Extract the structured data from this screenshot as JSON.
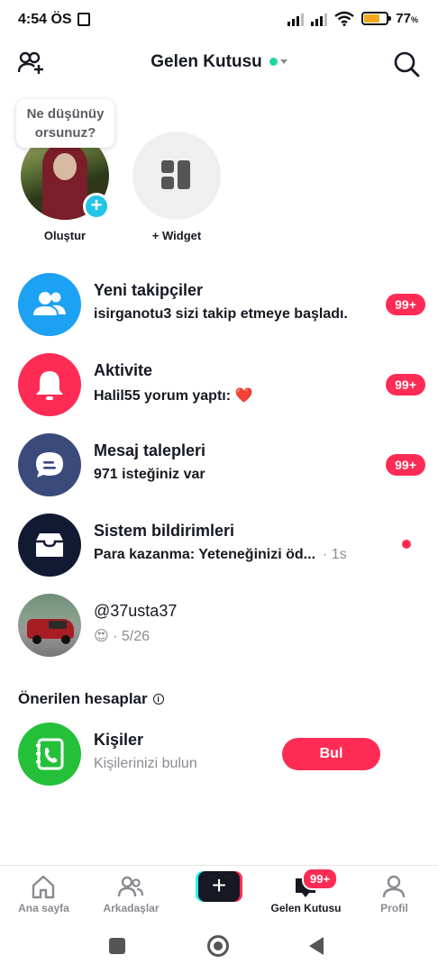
{
  "status_bar": {
    "time": "4:54 ÖS",
    "battery_percent": "77",
    "battery_unit": "%",
    "battery_level": 0.77
  },
  "header": {
    "title": "Gelen Kutusu",
    "status_color": "#20d5a0",
    "left_icon": "add-friend-icon",
    "right_icon": "search-icon"
  },
  "stories": {
    "bubble_text": "Ne düşünüy orsunuz?",
    "create_label": "Oluştur",
    "widget_label": "+ Widget"
  },
  "inbox": [
    {
      "title": "Yeni takipçiler",
      "subtitle": "isirganotu3 sizi takip etmeye başladı.",
      "badge": "99+",
      "icon": "followers-icon",
      "color": "#1da1f2"
    },
    {
      "title": "Aktivite",
      "subtitle": "Halil55 yorum yaptı: ",
      "emoji": "❤️",
      "badge": "99+",
      "icon": "bell-icon",
      "color": "#fe2c55"
    },
    {
      "title": "Mesaj talepleri",
      "subtitle": "971 isteğiniz var",
      "badge": "99+",
      "icon": "message-icon",
      "color": "#3a4a7a"
    },
    {
      "title": "Sistem bildirimleri",
      "subtitle": "Para kazanma: Yeteneğinizi öd...",
      "time": "· 1s",
      "icon": "inbox-tray-icon",
      "color": "#121a33"
    },
    {
      "title": "@37usta37",
      "emoji": "😍",
      "subtitle": " · 5/26"
    }
  ],
  "suggested": {
    "section_title": "Önerilen hesaplar",
    "name": "Kişiler",
    "description": "Kişilerinizi bulun",
    "button": "Bul",
    "icon_color": "#25c03a"
  },
  "bottom_nav": {
    "items": [
      {
        "label": "Ana sayfa",
        "icon": "home-icon"
      },
      {
        "label": "Arkadaşlar",
        "icon": "friends-icon"
      },
      {
        "label": "Gelen Kutusu",
        "icon": "inbox-icon",
        "badge": "99+"
      },
      {
        "label": "Profil",
        "icon": "profile-icon"
      }
    ],
    "create_symbol": "+"
  }
}
